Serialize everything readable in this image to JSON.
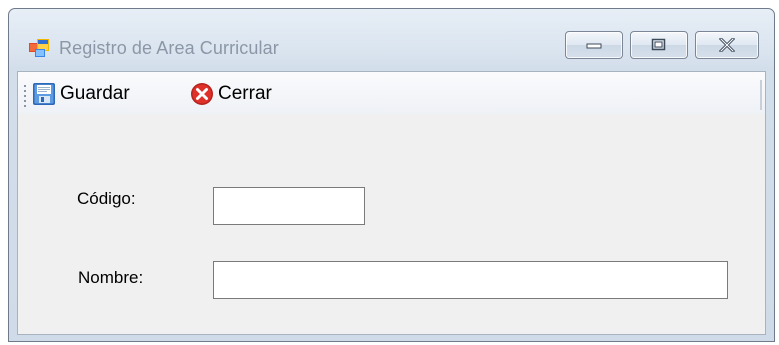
{
  "window": {
    "title": "Registro de Area Curricular",
    "icon": "app-window-icon"
  },
  "caption_buttons": {
    "minimize_icon": "minimize-icon",
    "maximize_icon": "maximize-icon",
    "close_icon": "close-icon"
  },
  "toolbar": {
    "save_label": "Guardar",
    "save_icon": "floppy-disk-icon",
    "close_label": "Cerrar",
    "close_icon": "red-x-circle-icon"
  },
  "form": {
    "codigo_label": "Código:",
    "codigo_value": "",
    "nombre_label": "Nombre:",
    "nombre_value": ""
  },
  "colors": {
    "title_text": "#8b97a6",
    "client_bg": "#f0f0f0",
    "close_icon_red": "#e0302a"
  }
}
